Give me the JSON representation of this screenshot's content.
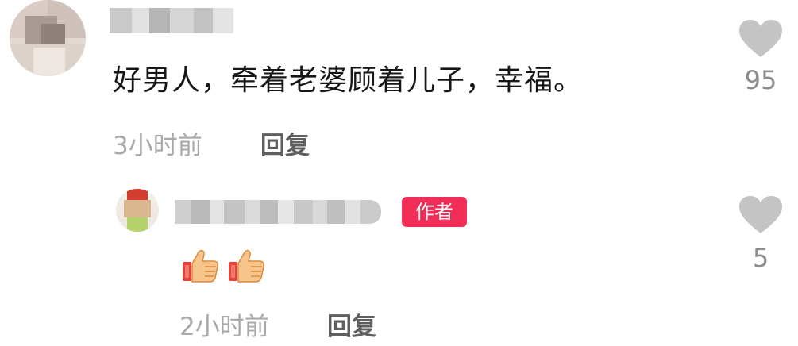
{
  "comments": [
    {
      "text": "好男人，牵着老婆顾着儿子，幸福。",
      "time": "3小时前",
      "reply_label": "回复",
      "likes": "95",
      "username_blurred": true
    },
    {
      "badge": "作者",
      "emoji": [
        "thumbs-up-icon",
        "thumbs-up-icon"
      ],
      "time": "2小时前",
      "reply_label": "回复",
      "likes": "5",
      "username_blurred": true
    }
  ],
  "colors": {
    "badge_bg": "#ef2d56",
    "heart": "#c4c4c4",
    "meta_text": "#a9a9a9",
    "reply_text": "#5f5f5f"
  }
}
